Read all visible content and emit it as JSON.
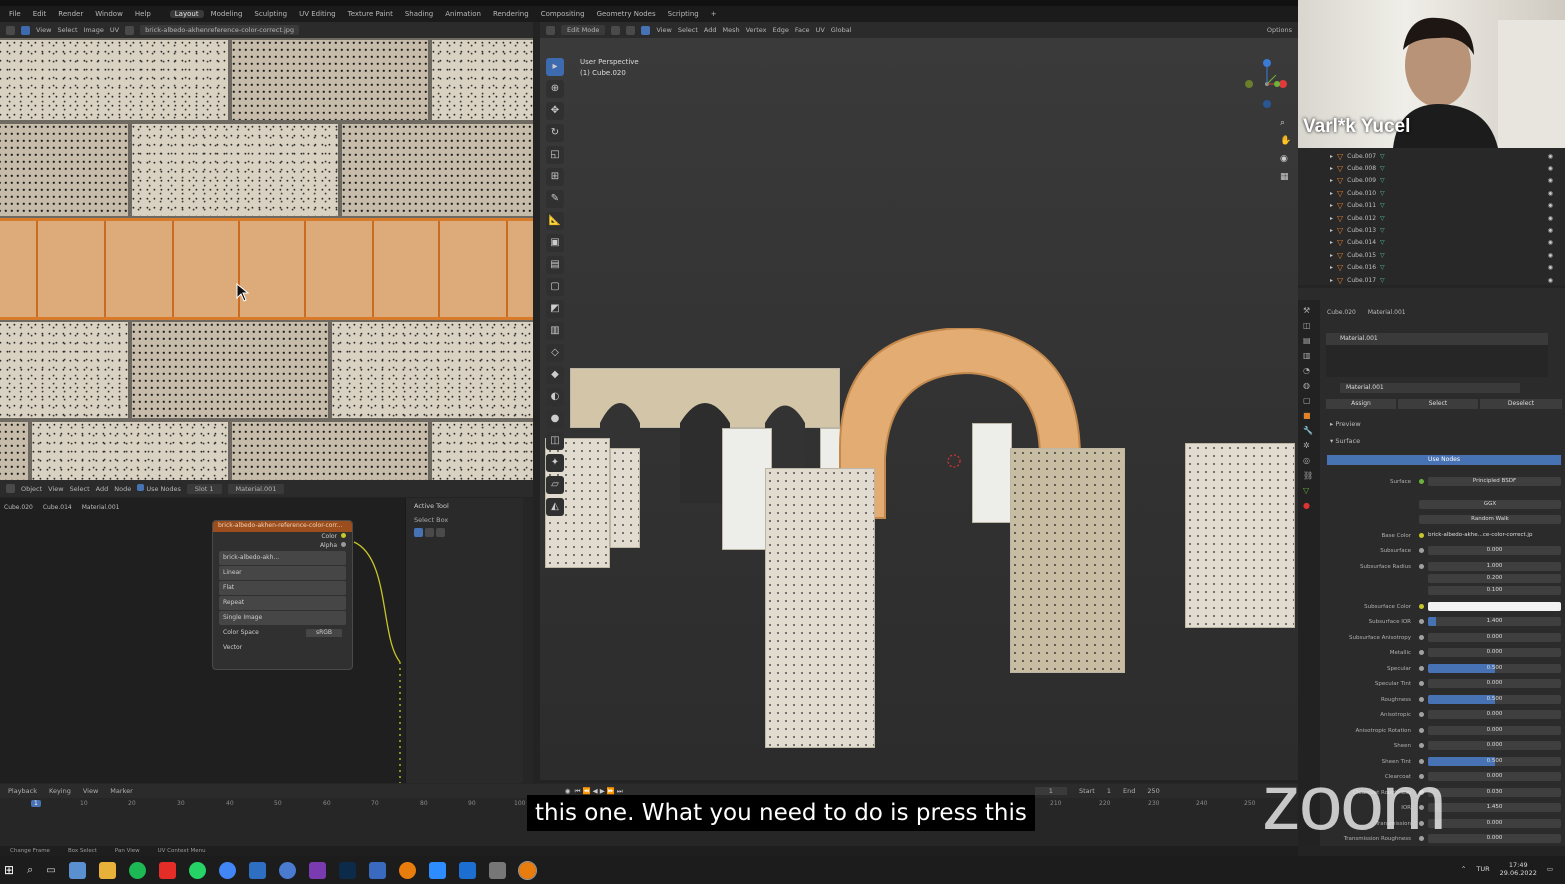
{
  "menu": {
    "items": [
      "File",
      "Edit",
      "Render",
      "Window",
      "Help"
    ],
    "workspaces": [
      "Layout",
      "Modeling",
      "Sculpting",
      "UV Editing",
      "Texture Paint",
      "Shading",
      "Animation",
      "Rendering",
      "Compositing",
      "Geometry Nodes",
      "Scripting",
      "+"
    ],
    "active_workspace": "Layout"
  },
  "image_editor": {
    "header_items": [
      "View",
      "Select",
      "Image",
      "UV"
    ],
    "image_name": "brick-albedo-akhenreference-color-correct.jpg"
  },
  "viewport": {
    "mode": "Edit Mode",
    "menus": [
      "View",
      "Select",
      "Add",
      "Mesh",
      "Vertex",
      "Edge",
      "Face",
      "UV"
    ],
    "transform": "Global",
    "options_label": "Options",
    "overlay_line1": "User Perspective",
    "overlay_line2": "(1) Cube.020"
  },
  "node_editor": {
    "header_items": [
      "Object",
      "View",
      "Select",
      "Add",
      "Node"
    ],
    "use_nodes_label": "Use Nodes",
    "slot": "Slot 1",
    "material": "Material.001",
    "breadcrumb": [
      "Cube.020",
      "Cube.014",
      "Material.001"
    ],
    "node_title": "brick-albedo-akhen-reference-color-corr...",
    "out_color": "Color",
    "out_alpha": "Alpha",
    "image_field": "brick-albedo-akh...",
    "interpolation": "Linear",
    "projection": "Flat",
    "extension": "Repeat",
    "source": "Single Image",
    "color_space_label": "Color Space",
    "color_space": "sRGB",
    "vector_label": "Vector",
    "npanel_title": "Active Tool",
    "npanel_tool": "Select Box",
    "side_tabs": [
      "Tool",
      "View",
      "Options",
      "Group",
      "Node Wrangler"
    ]
  },
  "webcam": {
    "name": "Varl*k Yucel"
  },
  "outliner": {
    "items": [
      "Cube.007",
      "Cube.008",
      "Cube.009",
      "Cube.010",
      "Cube.011",
      "Cube.012",
      "Cube.013",
      "Cube.014",
      "Cube.015",
      "Cube.016",
      "Cube.017"
    ]
  },
  "properties": {
    "breadcrumb_obj": "Cube.020",
    "breadcrumb_mat": "Material.001",
    "slot_item": "Material.001",
    "mat_field": "Material.001",
    "assign": "Assign",
    "select": "Select",
    "deselect": "Deselect",
    "preview": "Preview",
    "surface_section": "Surface",
    "use_nodes": "Use Nodes",
    "surface_label": "Surface",
    "surface_value": "Principled BSDF",
    "distribution": "GGX",
    "subsurface_method": "Random Walk",
    "rows": [
      {
        "label": "Base Color",
        "value": "brick-albedo-akhe...ce-color-correct.jp",
        "fill": 0
      },
      {
        "label": "Subsurface",
        "value": "0.000",
        "fill": 0
      },
      {
        "label": "Subsurface Radius",
        "value": "1.000",
        "fill": 0
      },
      {
        "label": "",
        "value": "0.200",
        "fill": 0
      },
      {
        "label": "",
        "value": "0.100",
        "fill": 0
      },
      {
        "label": "Subsurface Color",
        "value": "",
        "fill": 0
      },
      {
        "label": "Subsurface IOR",
        "value": "1.400",
        "fill": 0.06
      },
      {
        "label": "Subsurface Anisotropy",
        "value": "0.000",
        "fill": 0
      },
      {
        "label": "Metallic",
        "value": "0.000",
        "fill": 0
      },
      {
        "label": "Specular",
        "value": "0.500",
        "fill": 0.5
      },
      {
        "label": "Specular Tint",
        "value": "0.000",
        "fill": 0
      },
      {
        "label": "Roughness",
        "value": "0.500",
        "fill": 0.5
      },
      {
        "label": "Anisotropic",
        "value": "0.000",
        "fill": 0
      },
      {
        "label": "Anisotropic Rotation",
        "value": "0.000",
        "fill": 0
      },
      {
        "label": "Sheen",
        "value": "0.000",
        "fill": 0
      },
      {
        "label": "Sheen Tint",
        "value": "0.500",
        "fill": 0.5
      },
      {
        "label": "Clearcoat",
        "value": "0.000",
        "fill": 0
      },
      {
        "label": "Clearcoat Roughness",
        "value": "0.030",
        "fill": 0
      },
      {
        "label": "IOR",
        "value": "1.450",
        "fill": 0
      },
      {
        "label": "Transmission",
        "value": "0.000",
        "fill": 0
      },
      {
        "label": "Transmission Roughness",
        "value": "0.000",
        "fill": 0
      }
    ]
  },
  "timeline": {
    "menus": [
      "Playback",
      "Keying",
      "View",
      "Marker"
    ],
    "current_frame": "1",
    "start_label": "Start",
    "start": "1",
    "end_label": "End",
    "end": "250",
    "ticks": [
      "10",
      "20",
      "30",
      "40",
      "50",
      "60",
      "70",
      "80",
      "90",
      "100",
      "210",
      "220",
      "230",
      "240",
      "250"
    ]
  },
  "statusbar": [
    "Change Frame",
    "Box Select",
    "Pan View",
    "UV Context Menu"
  ],
  "subtitle": "this one. What you need to do is press this",
  "zoom_logo": "zoom",
  "taskbar": {
    "lang": "TUR",
    "time": "17:49",
    "date": "29.06.2022"
  },
  "colors": {
    "accent": "#4772b3",
    "selection": "#d77a2a",
    "socket": "#c7c729"
  }
}
